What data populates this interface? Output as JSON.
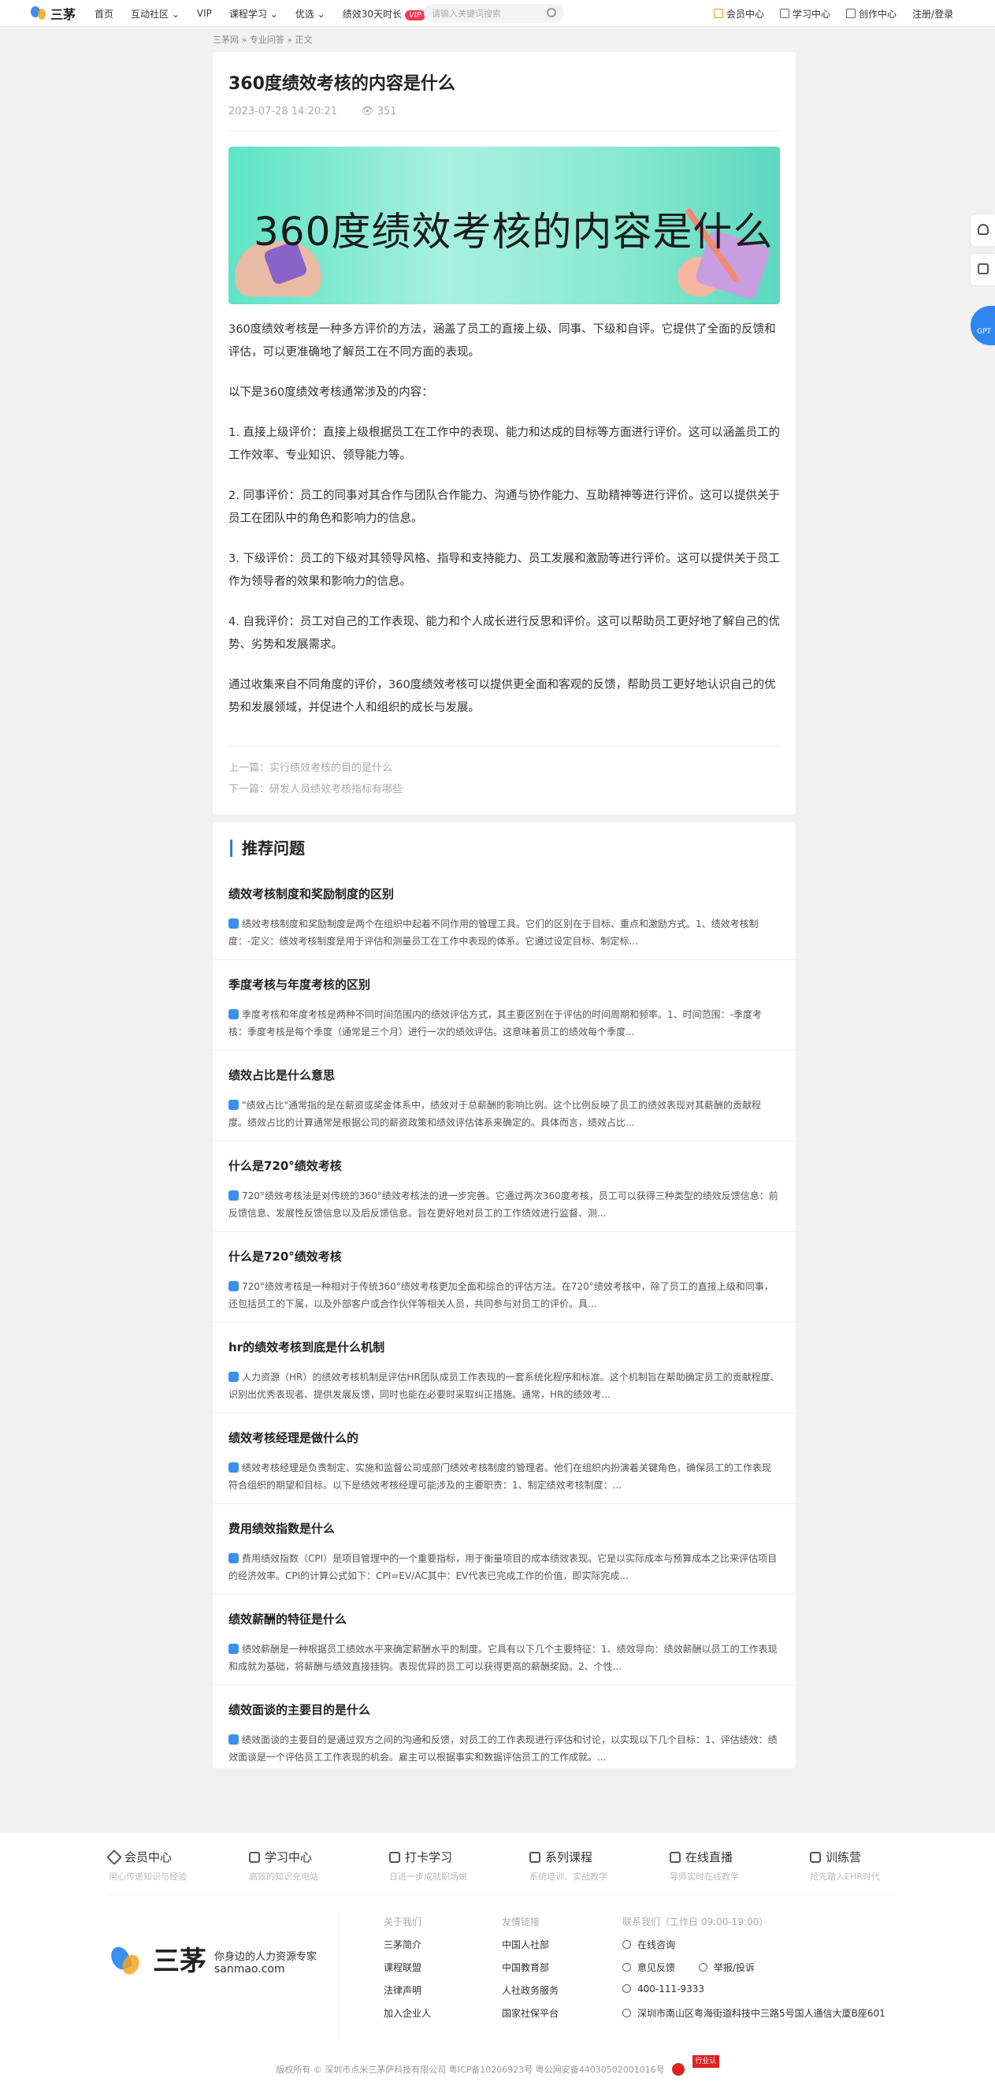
{
  "topbar": {
    "logo_text": "三茅",
    "nav": [
      "首页",
      "互动社区",
      "VIP",
      "课程学习",
      "优选",
      "绩效30天时长"
    ],
    "vip_badge": "VIP",
    "search_placeholder": "请输入关键词搜索",
    "right": [
      "会员中心",
      "学习中心",
      "创作中心",
      "注册/登录"
    ]
  },
  "breadcrumb": [
    "三茅网",
    "专业问答",
    "正文"
  ],
  "article": {
    "title": "360度绩效考核的内容是什么",
    "date": "2023-07-28 14:20:21",
    "views": "351",
    "banner_text": "360度绩效考核的内容是什么",
    "paragraphs": [
      "360度绩效考核是一种多方评价的方法，涵盖了员工的直接上级、同事、下级和自评。它提供了全面的反馈和评估，可以更准确地了解员工在不同方面的表现。",
      "以下是360度绩效考核通常涉及的内容：",
      "1. 直接上级评价：直接上级根据员工在工作中的表现、能力和达成的目标等方面进行评价。这可以涵盖员工的工作效率、专业知识、领导能力等。",
      "2. 同事评价：员工的同事对其合作与团队合作能力、沟通与协作能力、互助精神等进行评价。这可以提供关于员工在团队中的角色和影响力的信息。",
      "3. 下级评价：员工的下级对其领导风格、指导和支持能力、员工发展和激励等进行评价。这可以提供关于员工作为领导者的效果和影响力的信息。",
      "4. 自我评价：员工对自己的工作表现、能力和个人成长进行反思和评价。这可以帮助员工更好地了解自己的优势、劣势和发展需求。",
      "通过收集来自不同角度的评价，360度绩效考核可以提供更全面和客观的反馈，帮助员工更好地认识自己的优势和发展领域，并促进个人和组织的成长与发展。"
    ],
    "prev": "上一篇：实行绩效考核的目的是什么",
    "next": "下一篇：研发人员绩效考核指标有哪些"
  },
  "recommend": {
    "heading": "推荐问题",
    "items": [
      {
        "title": "绩效考核制度和奖励制度的区别",
        "desc": "绩效考核制度和奖励制度是两个在组织中起着不同作用的管理工具。它们的区别在于目标、重点和激励方式。1、绩效考核制度：-定义：绩效考核制度是用于评估和测量员工在工作中表现的体系。它通过设定目标、制定标..."
      },
      {
        "title": "季度考核与年度考核的区别",
        "desc": "季度考核和年度考核是两种不同时间范围内的绩效评估方式，其主要区别在于评估的时间周期和频率。1、时间范围：-季度考核：季度考核是每个季度（通常是三个月）进行一次的绩效评估。这意味着员工的绩效每个季度..."
      },
      {
        "title": "绩效占比是什么意思",
        "desc": "\"绩效占比\"通常指的是在薪资或奖金体系中，绩效对于总薪酬的影响比例。这个比例反映了员工的绩效表现对其薪酬的贡献程度。绩效占比的计算通常是根据公司的薪资政策和绩效评估体系来确定的。具体而言，绩效占比..."
      },
      {
        "title": "什么是720°绩效考核",
        "desc": "720°绩效考核法是对传统的360°绩效考核法的进一步完善。它通过两次360度考核，员工可以获得三种类型的绩效反馈信息：前反馈信息、发展性反馈信息以及后反馈信息。旨在更好地对员工的工作绩效进行监督、测..."
      },
      {
        "title": "什么是720°绩效考核",
        "desc": "720°绩效考核是一种相对于传统360°绩效考核更加全面和综合的评估方法。在720°绩效考核中，除了员工的直接上级和同事，还包括员工的下属，以及外部客户或合作伙伴等相关人员，共同参与对员工的评价。具..."
      },
      {
        "title": "hr的绩效考核到底是什么机制",
        "desc": "人力资源（HR）的绩效考核机制是评估HR团队成员工作表现的一套系统化程序和标准。这个机制旨在帮助确定员工的贡献程度、识别出优秀表现者、提供发展反馈，同时也能在必要时采取纠正措施。通常，HR的绩效考..."
      },
      {
        "title": "绩效考核经理是做什么的",
        "desc": "绩效考核经理是负责制定、实施和监督公司或部门绩效考核制度的管理者。他们在组织内扮演着关键角色，确保员工的工作表现符合组织的期望和目标。以下是绩效考核经理可能涉及的主要职责：1、制定绩效考核制度：..."
      },
      {
        "title": "费用绩效指数是什么",
        "desc": "费用绩效指数（CPI）是项目管理中的一个重要指标，用于衡量项目的成本绩效表现。它是以实际成本与预算成本之比来评估项目的经济效率。CPI的计算公式如下：CPI=EV/AC其中：EV代表已完成工作的价值，即实际完成..."
      },
      {
        "title": "绩效薪酬的特征是什么",
        "desc": "绩效薪酬是一种根据员工绩效水平来确定薪酬水平的制度。它具有以下几个主要特征：1、绩效导向：绩效薪酬以员工的工作表现和成就为基础，将薪酬与绩效直接挂钩。表现优异的员工可以获得更高的薪酬奖励。2、个性..."
      },
      {
        "title": "绩效面谈的主要目的是什么",
        "desc": "绩效面谈的主要目的是通过双方之间的沟通和反馈，对员工的工作表现进行评估和讨论，以实现以下几个目标：1、评估绩效：绩效面谈是一个评估员工工作表现的机会。雇主可以根据事实和数据评估员工的工作成就。..."
      }
    ]
  },
  "footer": {
    "nav": [
      {
        "title": "会员中心",
        "sub": "用心传递知识与经验"
      },
      {
        "title": "学习中心",
        "sub": "高效的知识充电站"
      },
      {
        "title": "打卡学习",
        "sub": "日进一步成就职场蜕"
      },
      {
        "title": "系列课程",
        "sub": "系统培训、实战教学"
      },
      {
        "title": "在线直播",
        "sub": "导师实时在线教学"
      },
      {
        "title": "训练营",
        "sub": "抢先踏入EHR时代"
      }
    ],
    "brand_name": "三茅",
    "brand_slogan": "你身边的人力资源专家",
    "brand_url": "sanmao.com",
    "about": {
      "heading": "关于我们",
      "items": [
        "三茅简介",
        "课程联盟",
        "法律声明",
        "加入企业人"
      ]
    },
    "links": {
      "heading": "友情链接",
      "items": [
        "中国人社部",
        "中国教育部",
        "人社政务服务",
        "国家社保平台"
      ]
    },
    "contact": {
      "heading": "联系我们（工作日 09:00-19:00）",
      "online": "在线咨询",
      "feedback": "意见反馈",
      "report": "举报/投诉",
      "phone": "400-111-9333",
      "address": "深圳市南山区粤海街道科技中三路5号国人通信大厦B座601"
    },
    "copyright": "版权所有 © 深圳市点米三茅萨科技有限公司   粤ICP备10206923号   粤公网安备44030502001016号",
    "badge2": "行业认证"
  },
  "sidetools": {
    "gpt": "GPT"
  }
}
